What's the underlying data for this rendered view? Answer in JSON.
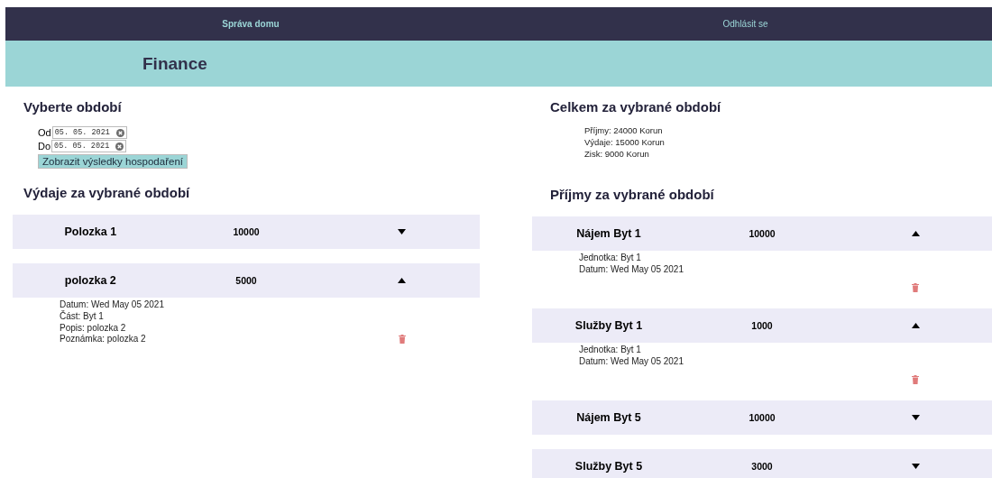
{
  "nav": {
    "brand": "Správa domu",
    "logout": "Odhlásit se"
  },
  "page_title": "Finance",
  "period": {
    "title": "Vyberte období",
    "fields": [
      {
        "label": "Od",
        "value": "05. 05. 2021"
      },
      {
        "label": "Do",
        "value": "05. 05. 2021"
      }
    ],
    "button": "Zobrazit výsledky hospodaření"
  },
  "expenses": {
    "title": "Výdaje za vybrané období",
    "items": [
      {
        "name": "Polozka 1",
        "amount": "10000",
        "expanded": false
      },
      {
        "name": "polozka 2",
        "amount": "5000",
        "expanded": true,
        "details": [
          "Datum: Wed May 05 2021",
          "Část: Byt 1",
          "Popis: polozka 2",
          "Poznámka: polozka 2"
        ]
      }
    ]
  },
  "totals": {
    "title": "Celkem za vybrané období",
    "lines": [
      "Příjmy: 24000 Korun",
      "Výdaje: 15000 Korun",
      "Zisk: 9000 Korun"
    ]
  },
  "income": {
    "title": "Příjmy za vybrané období",
    "items": [
      {
        "name": "Nájem Byt 1",
        "amount": "10000",
        "expanded": true,
        "details": [
          "Jednotka: Byt 1",
          "Datum: Wed May 05 2021"
        ]
      },
      {
        "name": "Služby Byt 1",
        "amount": "1000",
        "expanded": true,
        "details": [
          "Jednotka: Byt 1",
          "Datum: Wed May 05 2021"
        ]
      },
      {
        "name": "Nájem Byt 5",
        "amount": "10000",
        "expanded": false
      },
      {
        "name": "Služby Byt 5",
        "amount": "3000",
        "expanded": false
      }
    ]
  }
}
